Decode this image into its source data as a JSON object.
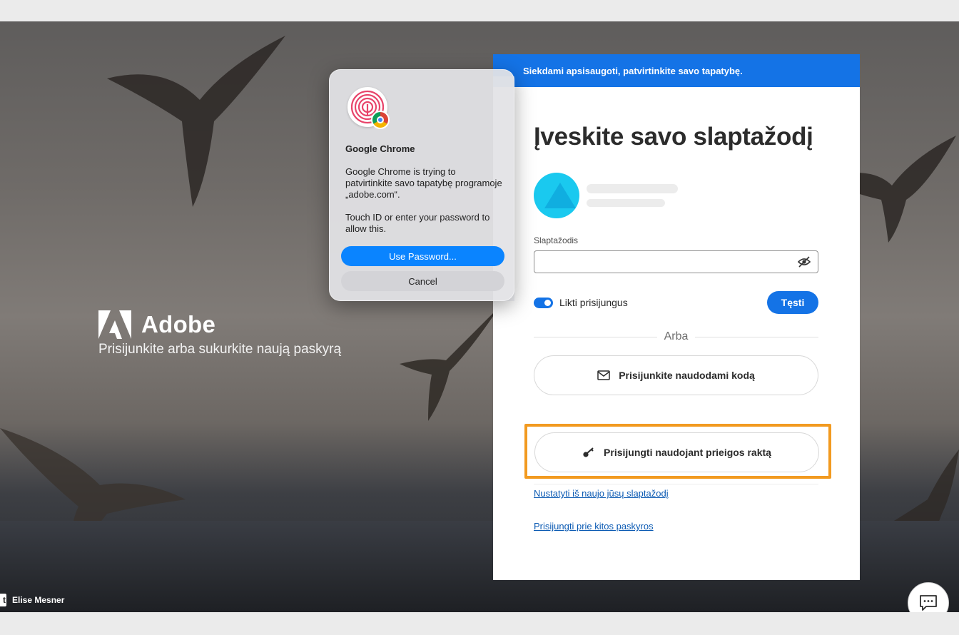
{
  "brand": {
    "name": "Adobe",
    "tagline": "Prisijunkite arba sukurkite naują paskyrą",
    "logo_icon": "adobe-logo"
  },
  "background": {
    "photo_credit": "Elise Mesner"
  },
  "signin_card": {
    "banner": "Siekdami apsisaugoti, patvirtinkite savo tapatybę.",
    "title": "Įveskite savo slaptažodį",
    "password_label": "Slaptažodis",
    "password_value": "",
    "visibility_icon": "eye-off-icon",
    "stay_signed_in_label": "Likti prisijungus",
    "stay_signed_in": true,
    "continue_label": "Tęsti",
    "or_label": "Arba",
    "code_signin_label": "Prisijunkite naudodami kodą",
    "code_signin_icon": "mail-icon",
    "passkey_signin_label": "Prisijungti naudojant prieigos raktą",
    "passkey_signin_icon": "key-icon",
    "reset_password_link": "Nustatyti iš naujo jūsų slaptažodį",
    "other_account_link": "Prisijungti prie kitos paskyros"
  },
  "touchid_dialog": {
    "app_name": "Google Chrome",
    "message": "Google Chrome is trying to patvirtinkite savo tapatybę programoje „adobe.com“.",
    "hint": "Touch ID or enter your password to allow this.",
    "primary_button": "Use Password...",
    "secondary_button": "Cancel",
    "icon": "fingerprint-icon"
  },
  "colors": {
    "accent": "#1473e6",
    "highlight": "#f29a20",
    "dialog_primary": "#0a84ff"
  }
}
